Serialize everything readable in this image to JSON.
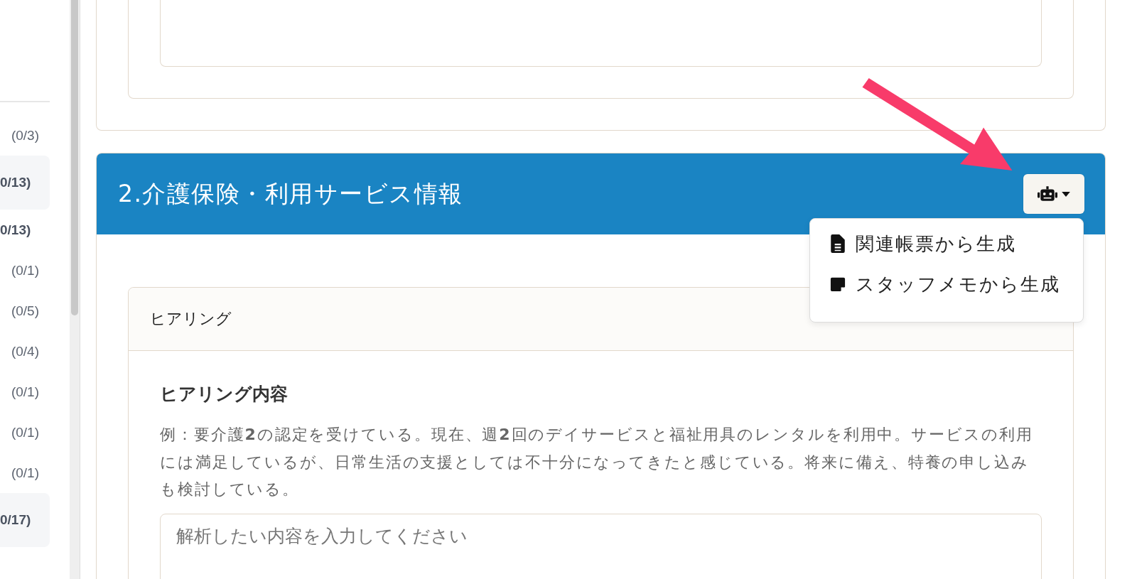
{
  "sidebar": {
    "items": [
      {
        "count": "(0/3)",
        "kind": "item",
        "selected": false
      },
      {
        "count": "0/13)",
        "kind": "group",
        "selected": true
      },
      {
        "count": "0/13)",
        "kind": "group",
        "selected": false
      },
      {
        "count": "(0/1)",
        "kind": "item",
        "selected": false
      },
      {
        "count": "(0/5)",
        "kind": "item",
        "selected": false
      },
      {
        "count": "(0/4)",
        "kind": "item",
        "selected": false
      },
      {
        "count": "(0/1)",
        "kind": "item",
        "selected": false
      },
      {
        "count": "(0/1)",
        "kind": "item",
        "selected": false
      },
      {
        "count": "(0/1)",
        "kind": "item",
        "selected": false
      },
      {
        "count": "0/17)",
        "kind": "group",
        "selected": true
      }
    ]
  },
  "section": {
    "title": "2.介護保険・利用サービス情報",
    "ai_menu": {
      "expanded": true,
      "items": [
        {
          "label": "関連帳票から生成",
          "kind": "document"
        },
        {
          "label": "スタッフメモから生成",
          "kind": "note"
        }
      ]
    },
    "card": {
      "header": "ヒアリング",
      "field_label": "ヒアリング内容",
      "hint": "例：要介護**2**の認定を受けている。現在、週**2**回のデイサービスと福祉用具のレンタルを利用中。サービスの利用には満足しているが、日常生活の支援としては不十分になってきたと感じている。将来に備え、特養の申し込みも検討している。",
      "placeholder": "解析したい内容を入力してください"
    }
  }
}
